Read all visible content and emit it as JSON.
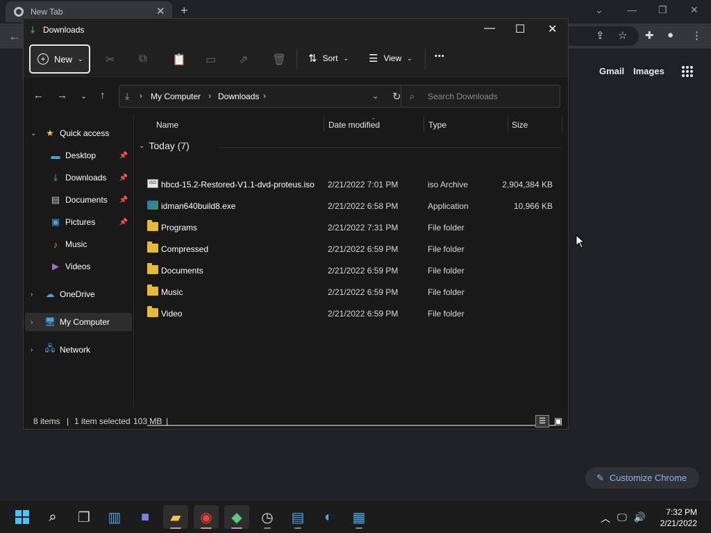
{
  "chrome": {
    "tab_title": "New Tab",
    "new_tab": "+",
    "gmail": "Gmail",
    "images": "Images",
    "customize": "Customize Chrome"
  },
  "explorer": {
    "title": "Downloads",
    "cmd": {
      "new_label": "New",
      "sort_label": "Sort",
      "view_label": "View",
      "more_label": "•••"
    },
    "breadcrumb": [
      "My Computer",
      "Downloads"
    ],
    "search_placeholder": "Search Downloads",
    "nav": {
      "quick_access": "Quick access",
      "desktop": "Desktop",
      "downloads": "Downloads",
      "documents": "Documents",
      "pictures": "Pictures",
      "music": "Music",
      "videos": "Videos",
      "onedrive": "OneDrive",
      "my_computer": "My Computer",
      "network": "Network"
    },
    "columns": {
      "name": "Name",
      "date": "Date modified",
      "type": "Type",
      "size": "Size"
    },
    "group_label": "Today (7)",
    "files": [
      {
        "name": "hbcd-15.2-Restored-V1.1-dvd-proteus.iso",
        "date": "2/21/2022 7:01 PM",
        "type": "iso Archive",
        "size": "2,904,384 KB",
        "icon": "iso-icon"
      },
      {
        "name": "idman640build8.exe",
        "date": "2/21/2022 6:58 PM",
        "type": "Application",
        "size": "10,966 KB",
        "icon": "exe-icon"
      },
      {
        "name": "Programs",
        "date": "2/21/2022 7:31 PM",
        "type": "File folder",
        "size": "",
        "icon": "folder-icon"
      },
      {
        "name": "Compressed",
        "date": "2/21/2022 6:59 PM",
        "type": "File folder",
        "size": "",
        "icon": "folder-icon"
      },
      {
        "name": "Documents",
        "date": "2/21/2022 6:59 PM",
        "type": "File folder",
        "size": "",
        "icon": "folder-icon"
      },
      {
        "name": "Music",
        "date": "2/21/2022 6:59 PM",
        "type": "File folder",
        "size": "",
        "icon": "folder-icon"
      },
      {
        "name": "Video",
        "date": "2/21/2022 6:59 PM",
        "type": "File folder",
        "size": "",
        "icon": "folder-icon"
      }
    ],
    "status": {
      "items": "8 items",
      "selected": "1 item selected",
      "size": "103 MB"
    }
  },
  "taskbar": {
    "time": "7:32 PM",
    "date": "2/21/2022"
  },
  "colors": {
    "accent": "#4cc2ff",
    "folder": "#e8b839",
    "download_green": "#5dc97a"
  }
}
